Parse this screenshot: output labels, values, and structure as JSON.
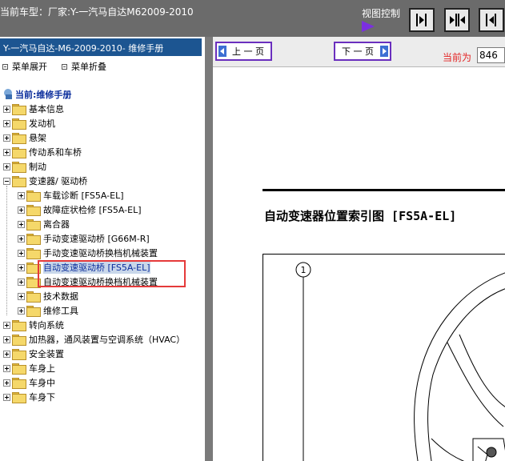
{
  "header": {
    "title": "当前车型：厂家:Y-一汽马自达M62009-2010",
    "view_control_label": "视图控制"
  },
  "sidebar": {
    "manual_title": "Y-一汽马自达-M6-2009-2010- 维修手册",
    "expand_label": "菜单展开",
    "collapse_label": "菜单折叠",
    "current_label": "当前:维修手册",
    "tree": [
      {
        "label": "基本信息",
        "level": 0,
        "state": "collapsed"
      },
      {
        "label": "发动机",
        "level": 0,
        "state": "collapsed"
      },
      {
        "label": "悬架",
        "level": 0,
        "state": "collapsed"
      },
      {
        "label": "传动系和车桥",
        "level": 0,
        "state": "collapsed"
      },
      {
        "label": "制动",
        "level": 0,
        "state": "collapsed"
      },
      {
        "label": "变速器/ 驱动桥",
        "level": 0,
        "state": "expanded"
      },
      {
        "label": "车载诊断 [FS5A-EL]",
        "level": 1,
        "state": "collapsed"
      },
      {
        "label": "故障症状检修 [FS5A-EL]",
        "level": 1,
        "state": "collapsed"
      },
      {
        "label": "离合器",
        "level": 1,
        "state": "collapsed"
      },
      {
        "label": "手动变速驱动桥 [G66M-R]",
        "level": 1,
        "state": "collapsed"
      },
      {
        "label": "手动变速驱动桥换档机械装置",
        "level": 1,
        "state": "collapsed"
      },
      {
        "label": "自动变速驱动桥 [FS5A-EL]",
        "level": 1,
        "state": "collapsed",
        "selected": true
      },
      {
        "label": "自动变速驱动桥换档机械装置",
        "level": 1,
        "state": "collapsed"
      },
      {
        "label": "技术数据",
        "level": 1,
        "state": "collapsed"
      },
      {
        "label": "维修工具",
        "level": 1,
        "state": "collapsed"
      },
      {
        "label": "转向系统",
        "level": 0,
        "state": "collapsed"
      },
      {
        "label": "加热器，通风装置与空调系统（HVAC）",
        "level": 0,
        "state": "collapsed"
      },
      {
        "label": "安全装置",
        "level": 0,
        "state": "collapsed"
      },
      {
        "label": "车身上",
        "level": 0,
        "state": "collapsed"
      },
      {
        "label": "车身中",
        "level": 0,
        "state": "collapsed"
      },
      {
        "label": "车身下",
        "level": 0,
        "state": "collapsed"
      }
    ]
  },
  "nav": {
    "prev_label": "上 一 页",
    "next_label": "下 一 页",
    "current_page_label": "当前为",
    "current_page_value": "846"
  },
  "document": {
    "title": "自动变速器位置索引图 [FS5A-EL]",
    "callout": "1"
  },
  "colors": {
    "accent_title_bar": "#1c5591",
    "selection_highlight": "#e53a3a",
    "nav_button_border": "#6a2fbe",
    "current_page_label": "#e32424"
  }
}
